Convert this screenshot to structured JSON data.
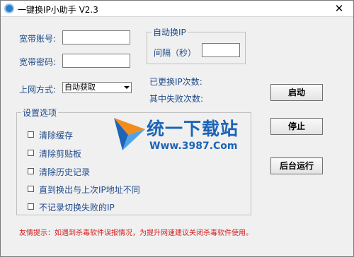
{
  "window": {
    "title": "一键换IP小助手 V2.3",
    "close_glyph": "✕"
  },
  "account": {
    "username_label": "宽带账号:",
    "username_value": "",
    "password_label": "宽带密码:",
    "password_value": ""
  },
  "network_mode": {
    "label": "上网方式:",
    "selected": "自动获取"
  },
  "auto_switch": {
    "title": "自动换IP",
    "interval_label": "间隔（秒）",
    "interval_value": ""
  },
  "stats": {
    "changed_label": "已更换IP次数:",
    "failed_label": "其中失败次数:"
  },
  "settings": {
    "title": "设置选项",
    "options": [
      {
        "label": "清除缓存",
        "checked": false
      },
      {
        "label": "清除剪贴板",
        "checked": false
      },
      {
        "label": "清除历史记录",
        "checked": false
      },
      {
        "label": "直到换出与上次IP地址不同",
        "checked": false
      },
      {
        "label": "不记录切换失败的IP",
        "checked": false
      }
    ]
  },
  "buttons": {
    "start": "启动",
    "stop": "停止",
    "background": "后台运行"
  },
  "notice": "友情提示：如遇到杀毒软件误报情况，为提升网速建议关闭杀毒软件使用。",
  "watermark": {
    "title": "统一下载站",
    "url": "Www.3987.Com"
  },
  "colors": {
    "label": "#1f4a8a",
    "notice": "#d42020",
    "watermark": "#1d64b8"
  }
}
